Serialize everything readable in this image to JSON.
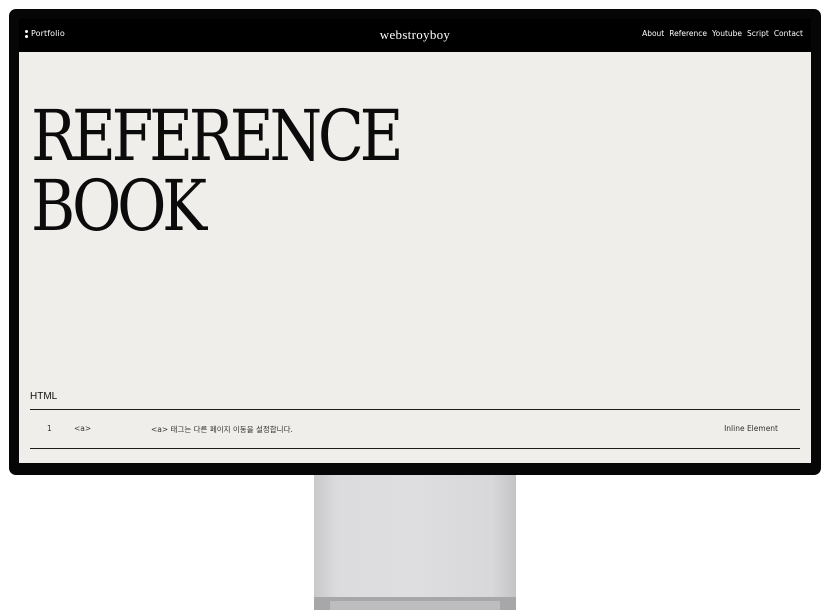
{
  "header": {
    "portfolio_label": "Portfolio",
    "logo": "webstroyboy",
    "nav": [
      {
        "label": "About"
      },
      {
        "label": "Reference"
      },
      {
        "label": "Youtube"
      },
      {
        "label": "Script"
      },
      {
        "label": "Contact"
      }
    ]
  },
  "hero": {
    "line1": "REFERENCE",
    "line2": "BOOK"
  },
  "section": {
    "title": "HTML",
    "rows": [
      {
        "num": "1",
        "tag": "<a>",
        "desc": "<a> 태그는 다른 페이지 이동을 설정합니다.",
        "type": "Inline Element"
      }
    ]
  },
  "colors": {
    "frame": "#060606",
    "screen_bg": "#efeeea",
    "header_bg": "#000000",
    "text": "#0b0b0b",
    "stand": "#dcdcde"
  },
  "icons": {
    "menu": "vertical-dots-icon"
  }
}
